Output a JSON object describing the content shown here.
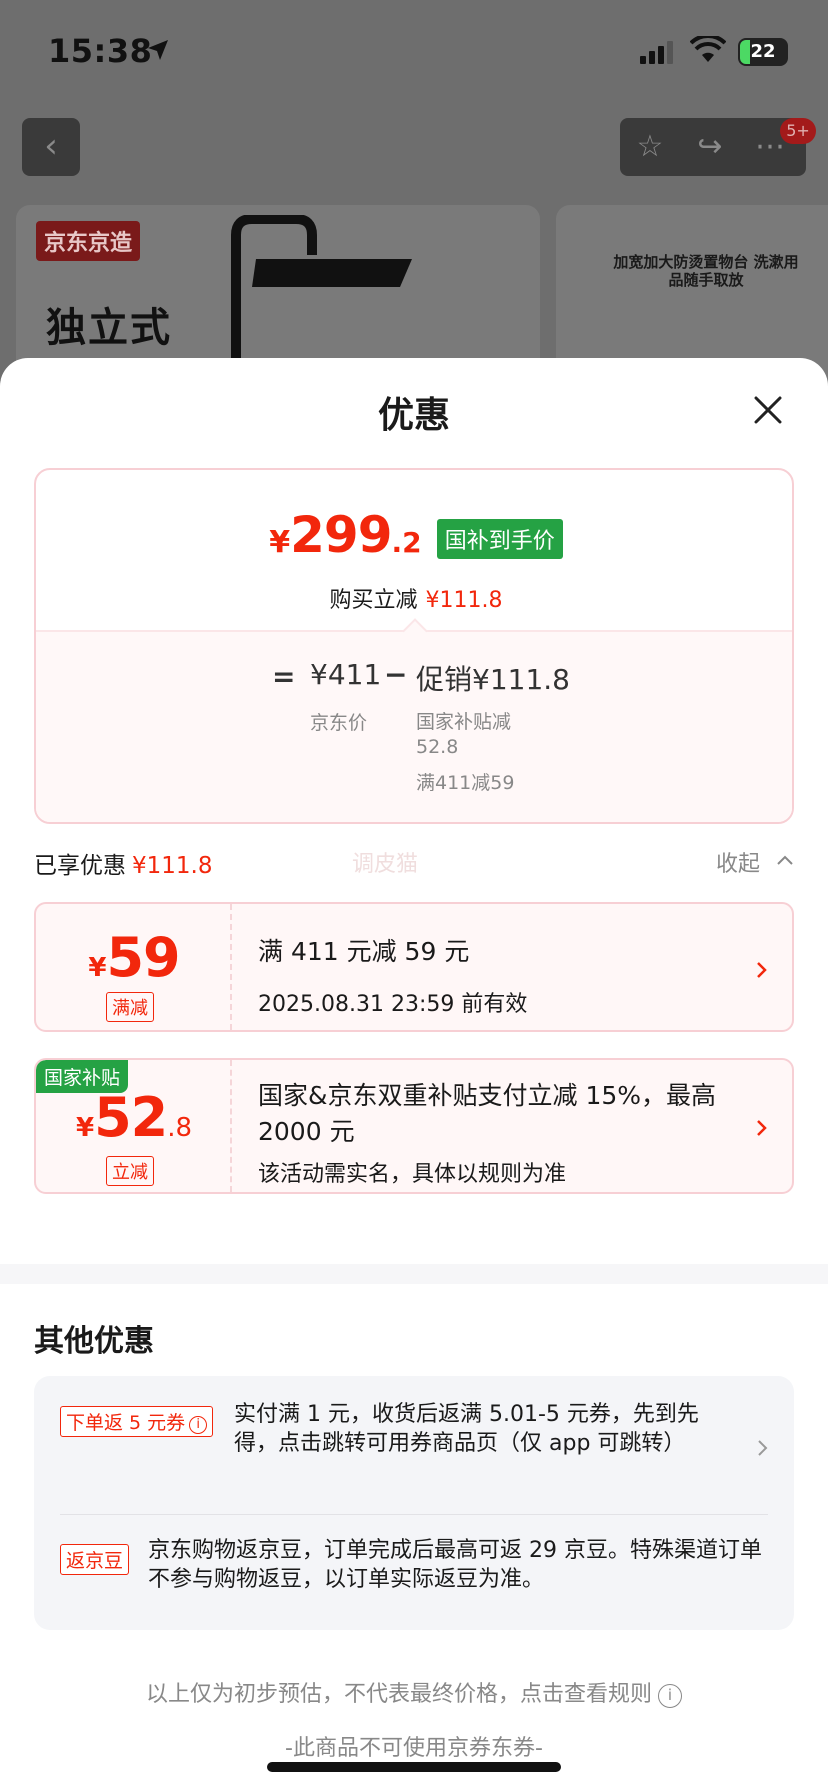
{
  "status_bar": {
    "time": "15:38",
    "battery": "22"
  },
  "nav": {
    "back_glyph": "‹",
    "badge": "5+"
  },
  "background_promo": {
    "brand": "京东京造",
    "title": "独立式",
    "right_text": "加宽加大防烫置物台 洗漱用品随手取放"
  },
  "sheet": {
    "title": "优惠",
    "price": {
      "currency": "¥",
      "integer": "299",
      "decimal": ".2",
      "tag": "国补到手价"
    },
    "reduce": {
      "label": "购买立减",
      "value": "¥111.8"
    },
    "breakdown": {
      "equals": "=",
      "jd_price": "¥411",
      "jd_price_label": "京东价",
      "minus": "−",
      "promo_total": "促销¥111.8",
      "promo_items": [
        "国家补贴减 52.8",
        "满411减59"
      ]
    },
    "enjoyed": {
      "label": "已享优惠",
      "value": "¥111.8",
      "watermark": "调皮猫",
      "collapse": "收起"
    },
    "coupons": [
      {
        "currency": "¥",
        "integer": "59",
        "decimal": "",
        "type": "满减",
        "ribbon": "",
        "title": "满 411 元减 59 元",
        "sub": "2025.08.31 23:59 前有效"
      },
      {
        "currency": "¥",
        "integer": "52",
        "decimal": ".8",
        "type": "立减",
        "ribbon": "国家补贴",
        "title": "国家&京东双重补贴支付立减 15%，最高 2000 元",
        "sub": "该活动需实名，具体以规则为准"
      }
    ],
    "other": {
      "title": "其他优惠",
      "rows": [
        {
          "tag": "下单返 5 元券",
          "text": "实付满 1 元，收货后返满 5.01-5 元券，先到先得，点击跳转可用券商品页（仅 app 可跳转）"
        },
        {
          "tag": "返京豆",
          "text": "京东购物返京豆，订单完成后最高可返 29 京豆。特殊渠道订单不参与购物返豆，以订单实际返豆为准。"
        }
      ]
    },
    "disclaimer": "以上仅为初步预估，不代表最终价格，点击查看规则",
    "no_coupon": "-此商品不可使用京券东券-"
  }
}
